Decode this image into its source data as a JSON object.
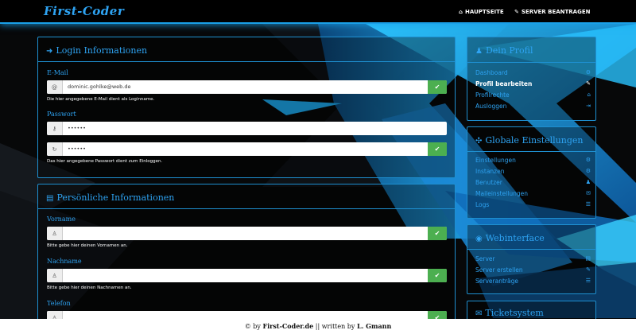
{
  "brand": "First-Coder",
  "nav": [
    {
      "icon": "home-icon",
      "label": "HAUPTSEITE"
    },
    {
      "icon": "edit-icon",
      "label": "SERVER BEANTRAGEN"
    }
  ],
  "login": {
    "title": "Login Informationen",
    "email_label": "E-Mail",
    "email_value": "dominic.gohlke@web.de",
    "email_hint": "Die hier angegebene E-Mail dient als Loginname.",
    "password_label": "Passwort",
    "password_value": "••••••",
    "password_repeat_value": "••••••",
    "password_hint": "Das hier angegebene Passwort dient zum Einloggen."
  },
  "personal": {
    "title": "Persönliche Informationen",
    "firstname_label": "Vorname",
    "firstname_value": "",
    "firstname_hint": "Bitte gebe hier deinen Vornamen an.",
    "lastname_label": "Nachname",
    "lastname_value": "",
    "lastname_hint": "Bitte gebe hier deinen Nachnamen an.",
    "phone_label": "Telefon",
    "phone_value": ""
  },
  "sidebar": {
    "profile_title": "Dein Profil",
    "profile_items": [
      "Dashboard",
      "Profil bearbeiten",
      "Profilrechte",
      "Ausloggen"
    ],
    "global_title": "Globale Einstellungen",
    "global_items": [
      "Einstellungen",
      "Instanzen",
      "Benutzer",
      "Maileinstellungen",
      "Logs"
    ],
    "web_title": "Webinterface",
    "web_items": [
      "Server",
      "Server erstellen",
      "Serveranträge"
    ],
    "ticket_title": "Ticketsystem"
  },
  "footer": {
    "prefix": "© by ",
    "site": "First-Coder.de",
    "middle": " || written by ",
    "author": "L. Gmann"
  },
  "colors": {
    "accent": "#2ea3f2",
    "success": "#4caf50",
    "background": "#050608"
  }
}
